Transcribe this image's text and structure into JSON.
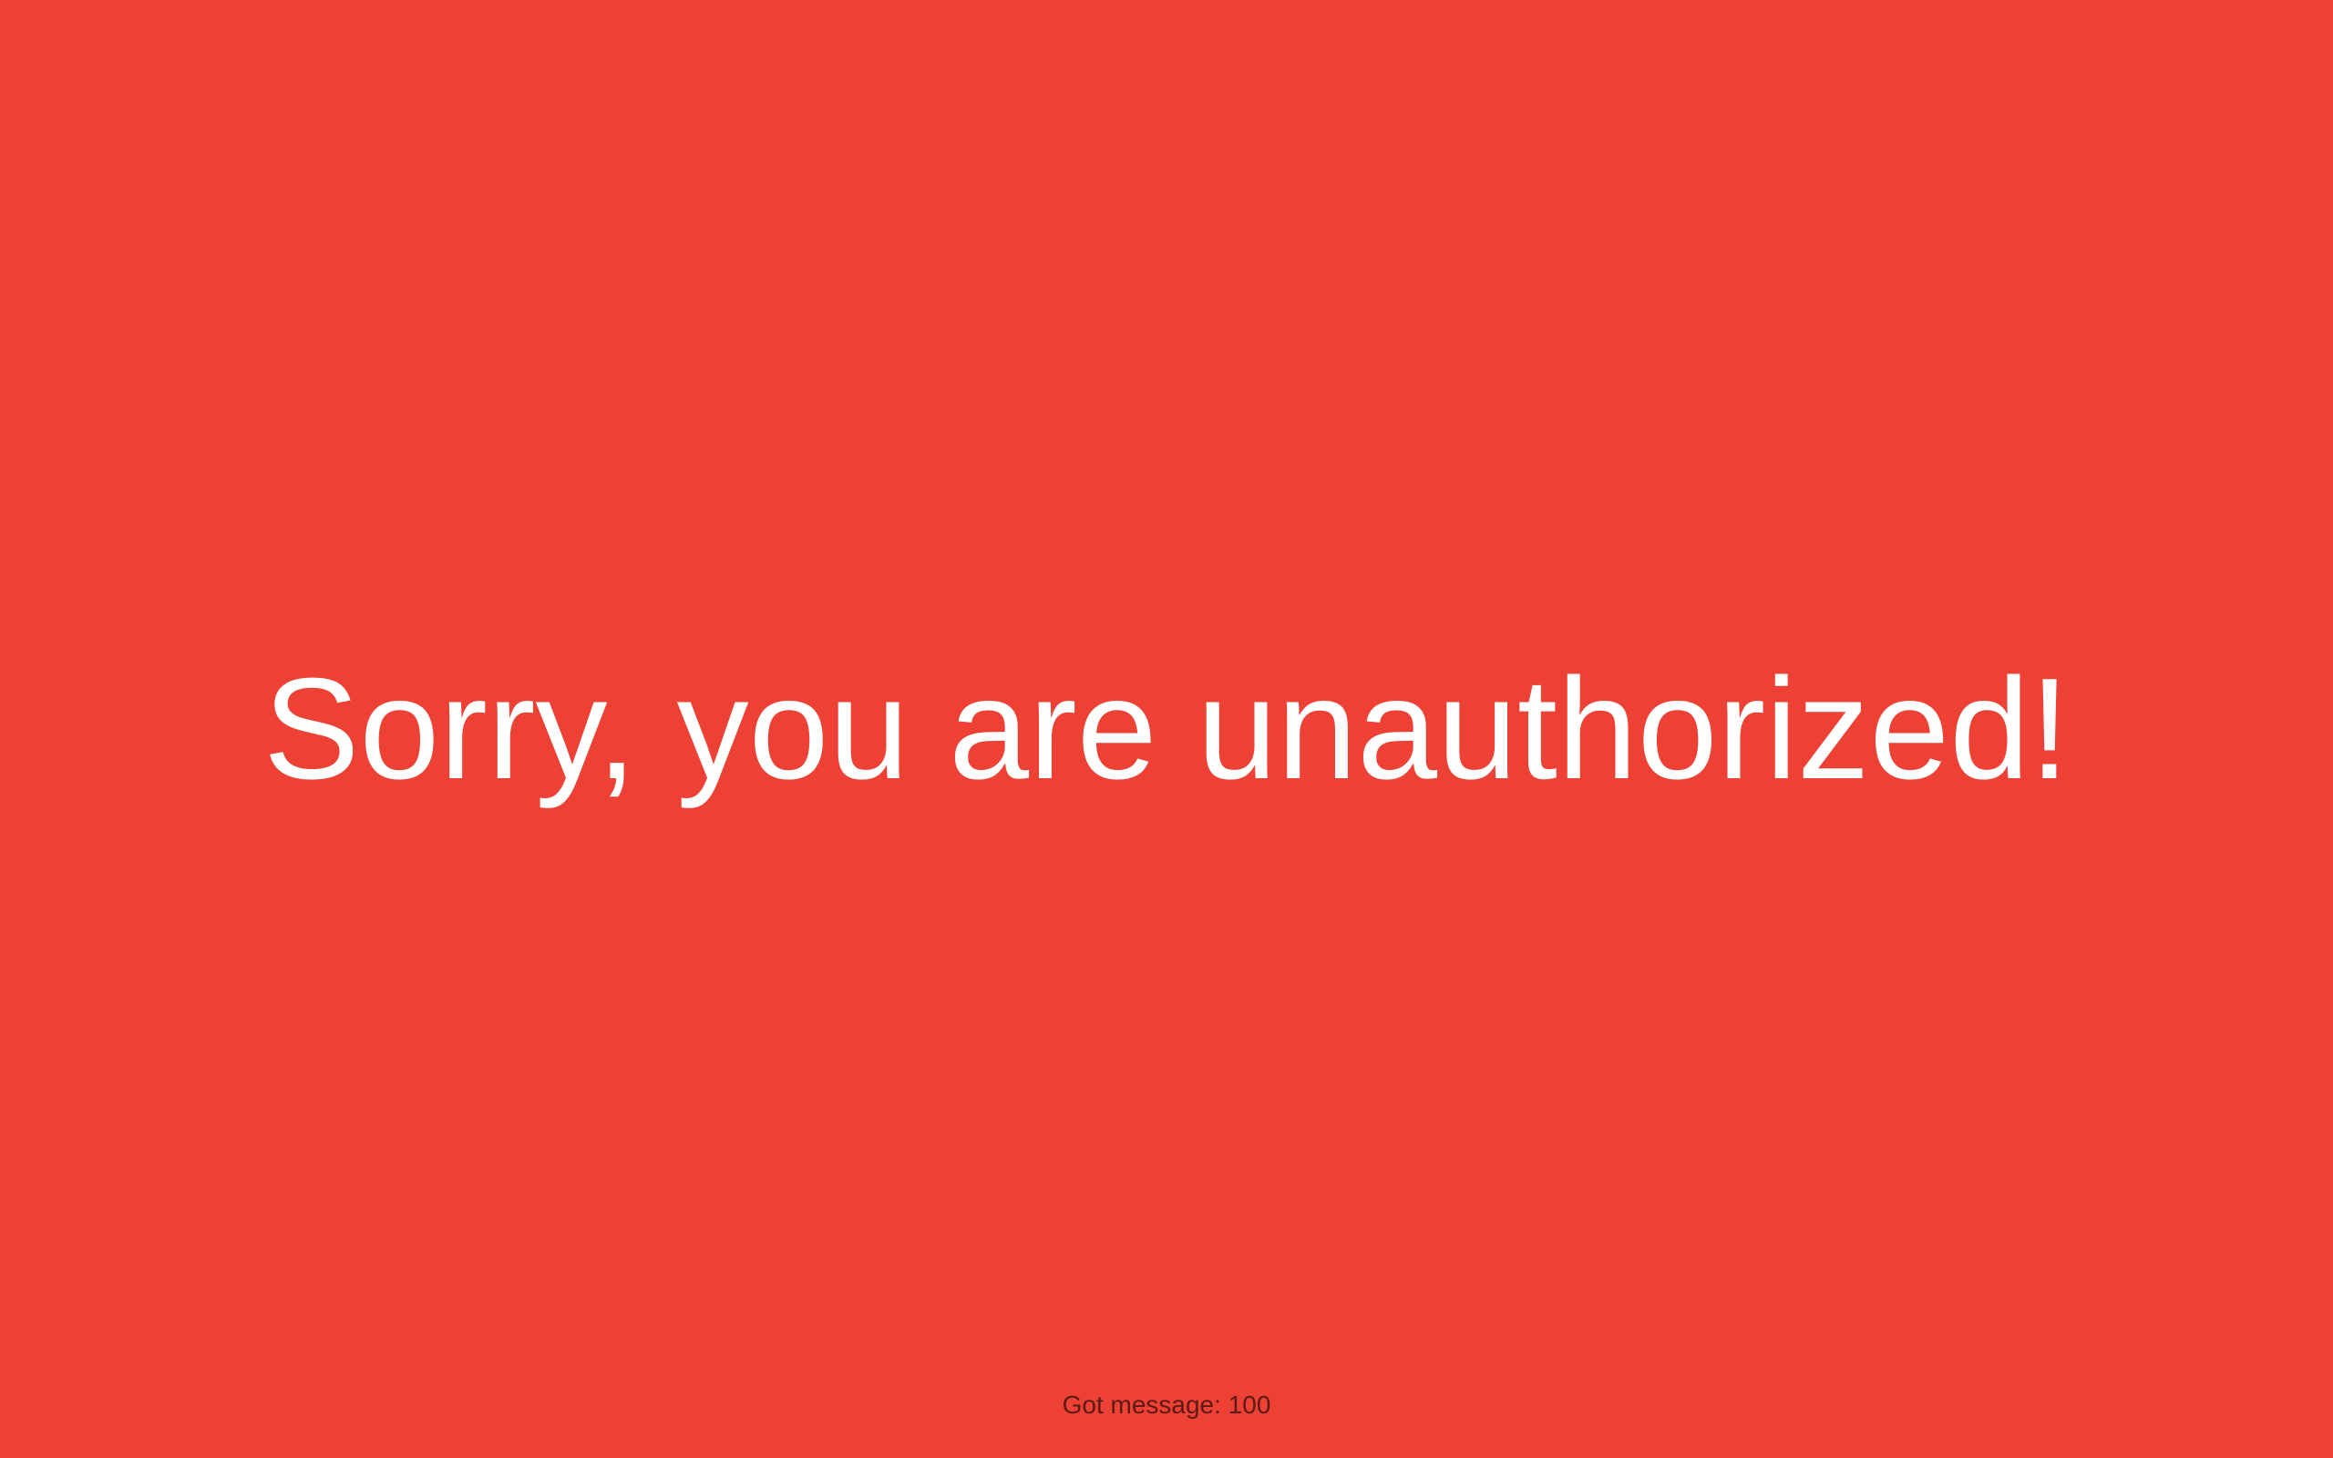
{
  "page": {
    "background_color": "#EE4136",
    "message": "Sorry, you are unauthorized!",
    "message_color": "#FFFFFF",
    "status_text": "Got message: 100",
    "status_color": "#5B1A14"
  }
}
